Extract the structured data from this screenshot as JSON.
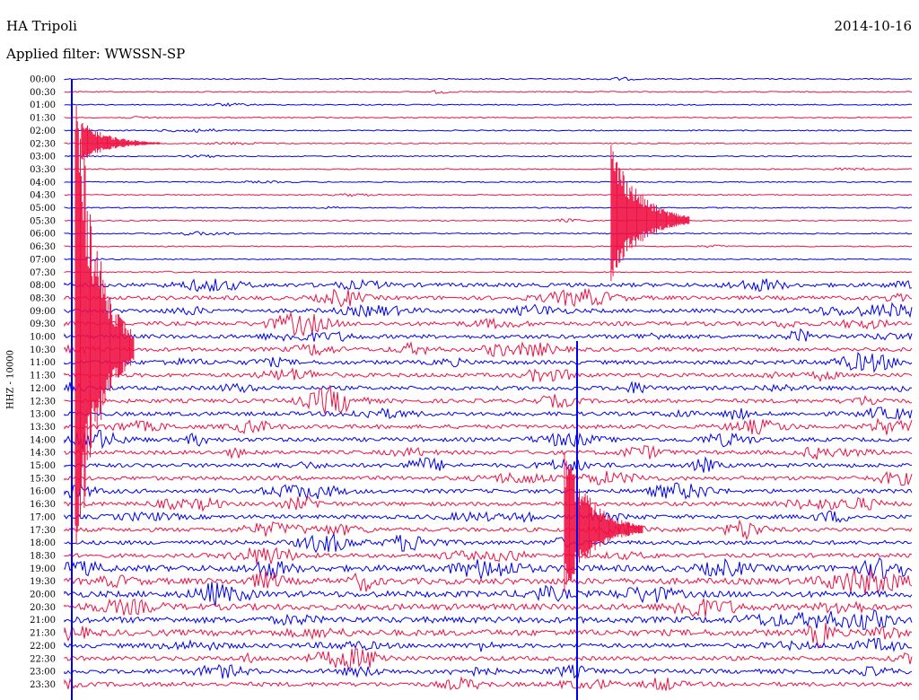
{
  "header": {
    "station": "HA Tripoli",
    "date": "2014-10-16",
    "filter": "Applied filter: WWSSN-SP"
  },
  "chart_data": {
    "type": "line",
    "title": "HA Tripoli",
    "subtitle": "Applied filter: WWSSN-SP",
    "ylabel": "HHZ - 10000",
    "row_labels": [
      "00:00",
      "00:30",
      "01:00",
      "01:30",
      "02:00",
      "02:30",
      "03:00",
      "03:30",
      "04:00",
      "04:30",
      "05:00",
      "05:30",
      "06:00",
      "06:30",
      "07:00",
      "07:30",
      "08:00",
      "08:30",
      "09:00",
      "09:30",
      "10:00",
      "10:30",
      "11:00",
      "11:30",
      "12:00",
      "12:30",
      "13:00",
      "13:30",
      "14:00",
      "14:30",
      "15:00",
      "15:30",
      "16:00",
      "16:30",
      "17:00",
      "17:30",
      "18:00",
      "18:30",
      "19:00",
      "19:30",
      "20:00",
      "20:30",
      "21:00",
      "21:30",
      "22:00",
      "22:30",
      "23:00",
      "23:30"
    ],
    "colors": [
      "#0000ee",
      "#ee1144"
    ],
    "events": [
      {
        "row_label": "02:30",
        "x_fraction": 0.02,
        "amplitude": "moderate"
      },
      {
        "row_label": "05:30",
        "x_fraction": 0.645,
        "amplitude": "large"
      },
      {
        "row_label": "10:30",
        "x_fraction": 0.0,
        "amplitude": "very large"
      },
      {
        "row_label": "17:30",
        "x_fraction": 0.59,
        "amplitude": "large"
      }
    ]
  }
}
